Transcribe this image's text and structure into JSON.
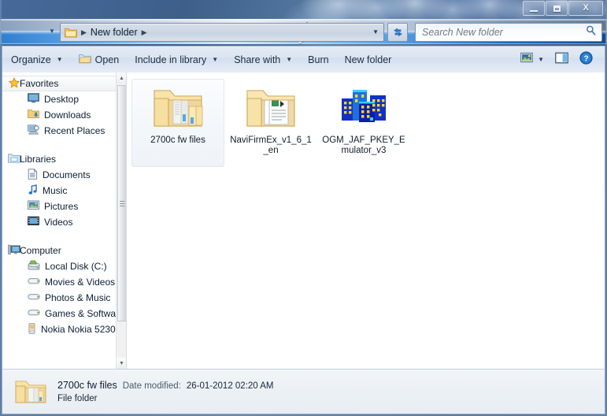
{
  "window": {
    "minimize_label": "Minimize",
    "maximize_label": "Maximize",
    "close_label": "X"
  },
  "address_bar": {
    "back_glyph": "◀",
    "forward_glyph": "▶",
    "recent_chevron": "▼",
    "folder_icon": "folder-icon",
    "crumb": "New folder",
    "separator": "▶",
    "dropdown_glyph": "▼",
    "refresh_icon": "refresh-icon"
  },
  "search": {
    "placeholder": "Search New folder",
    "icon": "search-icon"
  },
  "toolbar": {
    "organize": "Organize",
    "open": "Open",
    "include_in_library": "Include in library",
    "share_with": "Share with",
    "burn": "Burn",
    "new_folder": "New folder",
    "caret": "▼",
    "view_icon": "view-picture-icon",
    "preview_pane_icon": "preview-pane-icon",
    "help_icon": "help-icon"
  },
  "navigation": {
    "groups": [
      {
        "header": "Favorites",
        "header_icon": "star-icon",
        "selected": true,
        "items": [
          {
            "label": "Desktop",
            "icon": "desktop-icon"
          },
          {
            "label": "Downloads",
            "icon": "downloads-icon"
          },
          {
            "label": "Recent Places",
            "icon": "recent-places-icon"
          }
        ]
      },
      {
        "header": "Libraries",
        "header_icon": "libraries-icon",
        "selected": false,
        "items": [
          {
            "label": "Documents",
            "icon": "documents-icon"
          },
          {
            "label": "Music",
            "icon": "music-icon"
          },
          {
            "label": "Pictures",
            "icon": "pictures-icon"
          },
          {
            "label": "Videos",
            "icon": "videos-icon"
          }
        ]
      },
      {
        "header": "Computer",
        "header_icon": "computer-icon",
        "selected": false,
        "items": [
          {
            "label": "Local Disk (C:)",
            "icon": "local-disk-icon"
          },
          {
            "label": "Movies & Videos",
            "icon": "drive-icon"
          },
          {
            "label": "Photos & Music",
            "icon": "drive-icon"
          },
          {
            "label": "Games & Software",
            "icon": "drive-icon"
          },
          {
            "label": "Nokia Nokia 5230",
            "icon": "portable-device-icon"
          }
        ]
      }
    ]
  },
  "files": [
    {
      "name": "2700c fw files",
      "type": "folder",
      "selected": true
    },
    {
      "name": "NaviFirmEx_v1_6_1_en",
      "type": "folder-docs",
      "selected": false
    },
    {
      "name": "OGM_JAF_PKEY_Emulator_v3",
      "type": "application-buildings",
      "selected": false
    }
  ],
  "status_bar": {
    "icon": "folder-icon",
    "name": "2700c fw files",
    "date_modified_label": "Date modified:",
    "date_modified_value": "26-01-2012 02:20 AM",
    "item_type": "File folder"
  },
  "colors": {
    "accent": "#1767c4",
    "folder_yellow": "#fcdf8e",
    "title_blue": "#46699a"
  }
}
